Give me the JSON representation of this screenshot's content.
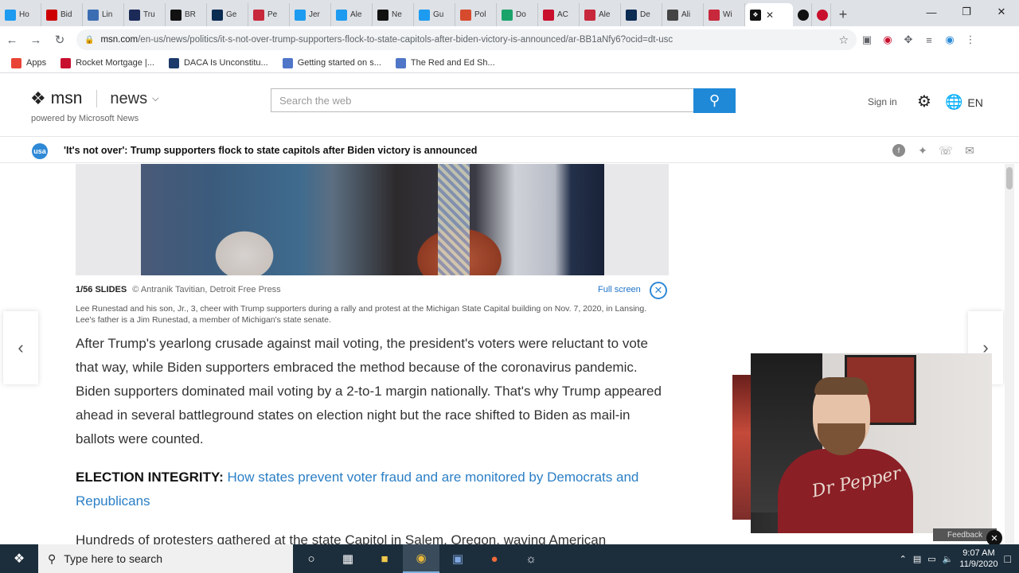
{
  "browser": {
    "tabs": [
      {
        "label": "Ho",
        "color": "#1d9bf0"
      },
      {
        "label": "Bid",
        "color": "#cc0000"
      },
      {
        "label": "Lin",
        "color": "#3b6db3"
      },
      {
        "label": "Tru",
        "color": "#1b2a57"
      },
      {
        "label": "BR",
        "color": "#111111"
      },
      {
        "label": "Ge",
        "color": "#0a2b52"
      },
      {
        "label": "Pe",
        "color": "#c7283b"
      },
      {
        "label": "Jer",
        "color": "#1d9bf0"
      },
      {
        "label": "Ale",
        "color": "#1d9bf0"
      },
      {
        "label": "Ne",
        "color": "#111111"
      },
      {
        "label": "Gu",
        "color": "#1d9bf0"
      },
      {
        "label": "Pol",
        "color": "#d64a2d"
      },
      {
        "label": "Do",
        "color": "#1aa36b"
      },
      {
        "label": "AC",
        "color": "#c8102e"
      },
      {
        "label": "Ale",
        "color": "#c7283b"
      },
      {
        "label": "De",
        "color": "#0a2b52"
      },
      {
        "label": "Ali",
        "color": "#444444"
      },
      {
        "label": "Wi",
        "color": "#c7283b"
      }
    ],
    "active_tab_icon": "msn-butterfly-icon",
    "new_tab": "+",
    "url_domain": "msn.com",
    "url_path": "/en-us/news/politics/it-s-not-over-trump-supporters-flock-to-state-capitols-after-biden-victory-is-announced/ar-BB1aNfy6?ocid=dt-usc",
    "bookmarks": [
      {
        "label": "Apps",
        "color": "#e94335"
      },
      {
        "label": "Rocket Mortgage |...",
        "color": "#c8102e"
      },
      {
        "label": "DACA Is Unconstitu...",
        "color": "#1b3a6b"
      },
      {
        "label": "Getting started on s...",
        "color": "#4f76c7"
      },
      {
        "label": "The Red and Ed Sh...",
        "color": "#4f76c7"
      }
    ]
  },
  "msn": {
    "brand": "msn",
    "section": "news",
    "powered": "powered by Microsoft News",
    "search_placeholder": "Search the web",
    "signin": "Sign in",
    "language": "EN",
    "accent": "#1f89d8"
  },
  "article": {
    "publisher_badge": "usa",
    "headline": "'It's not over': Trump supporters flock to state capitols after Biden victory is announced",
    "slide_counter": "1/56 SLIDES",
    "slide_credit": "© Antranik Tavitian, Detroit Free Press",
    "fullscreen": "Full screen",
    "caption": "Lee Runestad and his son, Jr., 3, cheer with Trump supporters during a rally and protest at the Michigan State Capital building on Nov. 7, 2020, in Lansing. Lee's father is a Jim Runestad, a member of Michigan's state senate.",
    "paragraph1": "After Trump's yearlong crusade against mail voting, the president's voters were reluctant to vote that way, while Biden supporters embraced the method because of the coronavirus pandemic. Biden supporters dominated mail voting by a 2-to-1 margin nationally. That's why Trump appeared ahead in several battleground states on election night but the race shifted to Biden as mail-in ballots were counted.",
    "integrity_label": "ELECTION INTEGRITY:",
    "integrity_link": "How states prevent voter fraud and are monitored by Democrats and Republicans",
    "paragraph3": "Hundreds of protesters gathered at the state Capitol in Salem, Oregon, waving American"
  },
  "webcam": {
    "shirt_text": "Dr Pepper",
    "feedback": "Feedback"
  },
  "taskbar": {
    "search_placeholder": "Type here to search",
    "time": "9:07 AM",
    "date": "11/9/2020"
  }
}
